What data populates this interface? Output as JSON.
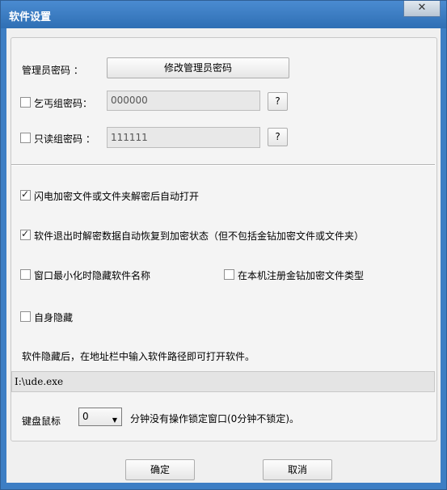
{
  "window": {
    "title": "软件设置",
    "close_glyph": "✕"
  },
  "admin": {
    "label": "管理员密码 ：",
    "button": "修改管理员密码"
  },
  "beggar": {
    "label": "乞丐组密码：",
    "value": "000000",
    "help": "?"
  },
  "readonly": {
    "label": "只读组密码 ：",
    "value": "111111",
    "help": "?"
  },
  "options": {
    "flash_open": {
      "label": "闪电加密文件或文件夹解密后自动打开",
      "checked": true
    },
    "restore_on_exit": {
      "label": "软件退出时解密数据自动恢复到加密状态（但不包括金钻加密文件或文件夹）",
      "checked": true
    },
    "hide_name_minimized": {
      "label": "窗口最小化时隐藏软件名称",
      "checked": false
    },
    "register_types": {
      "label": "在本机注册金钻加密文件类型",
      "checked": false
    },
    "self_hide": {
      "label": "自身隐藏",
      "checked": false
    }
  },
  "hide_hint": "软件隐藏后，在地址栏中输入软件路径即可打开软件。",
  "path": "I:\\ude.exe",
  "lock": {
    "label": "键盘鼠标",
    "minutes": "0",
    "suffix": "分钟没有操作锁定窗口(0分钟不锁定)。"
  },
  "buttons": {
    "ok": "确定",
    "cancel": "取消"
  }
}
